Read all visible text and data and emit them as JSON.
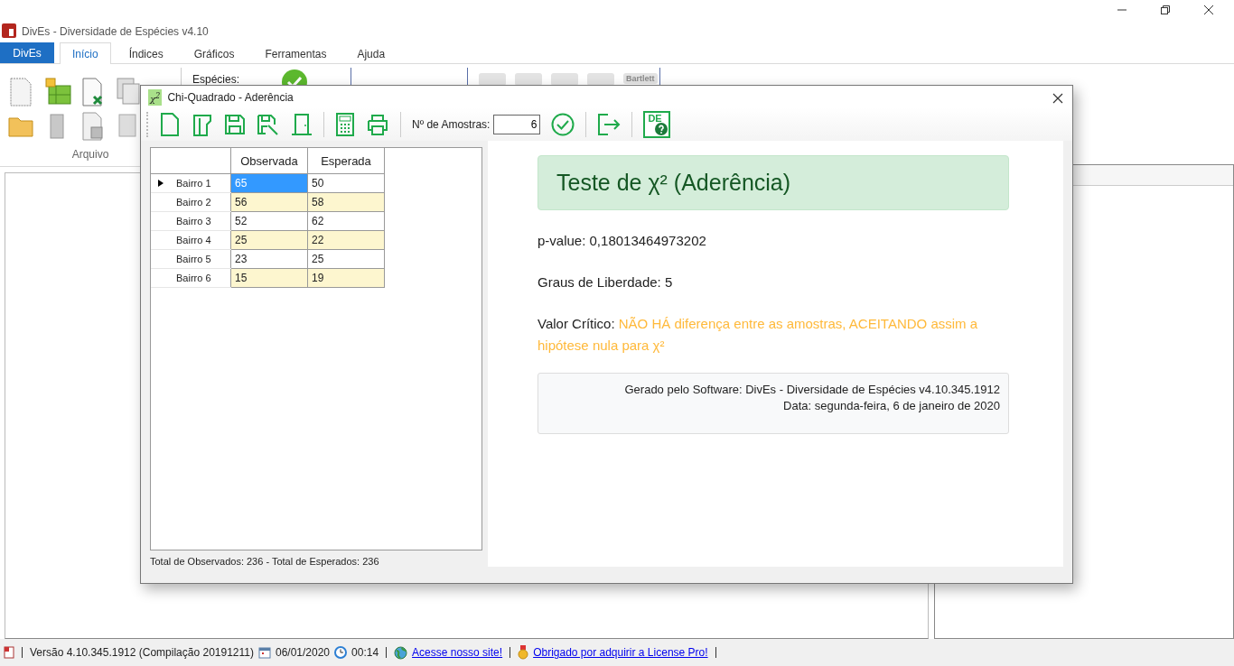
{
  "window": {
    "title": "DivEs - Diversidade de Espécies v4.10"
  },
  "ribbon": {
    "app_button": "DivEs",
    "tabs": [
      {
        "label": "Início",
        "selected": true
      },
      {
        "label": "Índices",
        "selected": false
      },
      {
        "label": "Gráficos",
        "selected": false
      },
      {
        "label": "Ferramentas",
        "selected": false
      },
      {
        "label": "Ajuda",
        "selected": false
      }
    ],
    "species_label": "Espécies:",
    "group_label": "Arquivo",
    "tool_label": "Bartlett"
  },
  "dialog": {
    "title": "Chi-Quadrado - Aderência",
    "title_icon_text": "χ$^{2}$",
    "samples_label": "Nº de Amostras:",
    "samples_value": "6",
    "help_badge": "DE",
    "table": {
      "columns": [
        "Observada",
        "Esperada"
      ],
      "rows": [
        {
          "label": "Bairro 1",
          "observada": "65",
          "esperada": "50",
          "selected": true
        },
        {
          "label": "Bairro 2",
          "observada": "56",
          "esperada": "58",
          "selected": false
        },
        {
          "label": "Bairro 3",
          "observada": "52",
          "esperada": "62",
          "selected": false
        },
        {
          "label": "Bairro 4",
          "observada": "25",
          "esperada": "22",
          "selected": false
        },
        {
          "label": "Bairro 5",
          "observada": "23",
          "esperada": "25",
          "selected": false
        },
        {
          "label": "Bairro 6",
          "observada": "15",
          "esperada": "19",
          "selected": false
        }
      ]
    },
    "totals": "Total de Observados: 236 - Total de Esperados: 236",
    "report": {
      "heading": "Teste de χ² (Aderência)",
      "p_value": "p-value: 0,18013464973202",
      "degrees": "Graus de Liberdade: 5",
      "critical_label": "Valor Crítico:",
      "critical_text": "NÃO HÁ diferença entre as amostras, ACEITANDO assim a hipótese nula para χ²",
      "footer": [
        "Gerado pelo Software: DivEs - Diversidade de Espécies v4.10.345.1912",
        "Data: segunda-feira, 6 de janeiro de 2020"
      ]
    }
  },
  "status_bar": {
    "version": "Versão 4.10.345.1912 (Compilação 20191211)",
    "date": "06/01/2020",
    "time": "00:14",
    "links": [
      "Acesse nosso site!",
      "Obrigado por adquirir a License Pro!"
    ]
  }
}
